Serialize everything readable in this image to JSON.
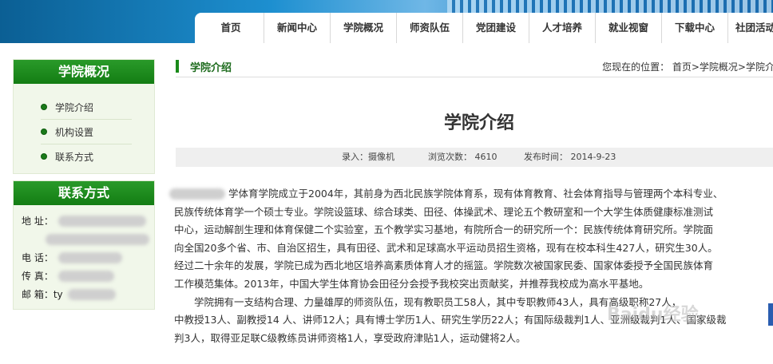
{
  "nav": [
    "首页",
    "新闻中心",
    "学院概况",
    "师资队伍",
    "党团建设",
    "人才培养",
    "就业视窗",
    "下载中心",
    "社团活动"
  ],
  "sidebar": {
    "overview_title": "学院概况",
    "items": [
      "学院介绍",
      "机构设置",
      "联系方式"
    ],
    "contact_title": "联系方式",
    "contact": [
      {
        "label": "地  址："
      },
      {
        "label": "电  话："
      },
      {
        "label": "传  真："
      },
      {
        "label": "邮  箱：",
        "value": "ty"
      }
    ]
  },
  "main": {
    "section_title": "学院介绍",
    "breadcrumb": "您现在的位置：  首页>学院概况>学院介",
    "article_title": "学院介绍",
    "meta": {
      "author": "录入：摄像机",
      "views": "浏览次数：  4610",
      "date": "发布时间：  2014-9-23"
    },
    "paragraphs": [
      "学体育学院成立于2004年，其前身为西北民族学院体育系，现有体育教育、社会体育指导与管理两个本科专业、",
      "民族传统体育学一个硕士专业。学院设篮球、综合球类、田径、体操武术、理论五个教研室和一个大学生体质健康标准测试",
      "中心，运动解剖生理和体育保健二个实验室，五个教学实习基地，有院所合一的研究所一个：民族传统体育研究所。学院面",
      "向全国20多个省、市、自治区招生，具有田径、武术和足球高水平运动员招生资格，现有在校本科生427人，研究生30人。",
      "经过二十余年的发展，学院已成为西北地区培养高素质体育人才的摇篮。学院数次被国家民委、国家体委授予全国民族体育",
      "工作模范集体。2013年，中国大学生体育协会田径分会授予我校突出贡献奖，并推荐我校成为高水平基地。",
      "　　学院拥有一支结构合理、力量雄厚的师资队伍，现有教职员工58人，其中专职教师43人，具有高级职称27人，",
      "中教授13人、副教授14 人、讲师12人；具有博士学历1人、研究生学历22人；有国际级裁判1人、亚洲级裁判1人、国家级裁",
      "判3人，取得亚足联C级教练员讲师资格1人，享受政府津贴1人，运动健将2人。"
    ]
  },
  "watermark": "Baidu经验"
}
